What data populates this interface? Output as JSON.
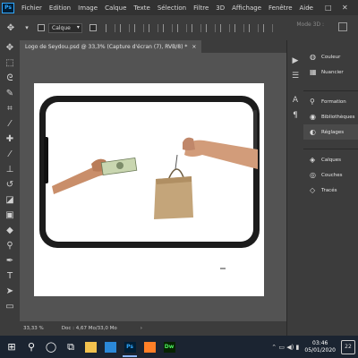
{
  "app": {
    "logo": "Ps"
  },
  "menu": [
    "Fichier",
    "Edition",
    "Image",
    "Calque",
    "Texte",
    "Sélection",
    "Filtre",
    "3D",
    "Affichage",
    "Fenêtre",
    "Aide"
  ],
  "window_controls": {
    "minimize": "–",
    "maximize": "□",
    "close": "✕"
  },
  "options": {
    "select_value": "Calque",
    "mode3d_label": "Mode 3D :"
  },
  "document": {
    "tab_title": "Logo de Seydou.psd @ 33,3% (Capture d'écran  (7), RVB/8) *",
    "close": "×"
  },
  "tools": [
    {
      "name": "move-tool",
      "icon": "✥"
    },
    {
      "name": "marquee-tool",
      "icon": "⬚"
    },
    {
      "name": "lasso-tool",
      "icon": "ᘓ"
    },
    {
      "name": "quick-select-tool",
      "icon": "✎"
    },
    {
      "name": "crop-tool",
      "icon": "⌗"
    },
    {
      "name": "eyedropper-tool",
      "icon": "⁄"
    },
    {
      "name": "healing-tool",
      "icon": "✚"
    },
    {
      "name": "brush-tool",
      "icon": "⁄"
    },
    {
      "name": "stamp-tool",
      "icon": "⊥"
    },
    {
      "name": "history-brush-tool",
      "icon": "↺"
    },
    {
      "name": "eraser-tool",
      "icon": "◪"
    },
    {
      "name": "gradient-tool",
      "icon": "▣"
    },
    {
      "name": "blur-tool",
      "icon": "◆"
    },
    {
      "name": "dodge-tool",
      "icon": "⚲"
    },
    {
      "name": "pen-tool",
      "icon": "✒"
    },
    {
      "name": "type-tool",
      "icon": "T"
    },
    {
      "name": "path-select-tool",
      "icon": "➤"
    },
    {
      "name": "shape-tool",
      "icon": "▭"
    }
  ],
  "panel_strip_icons": [
    "▶",
    "☰",
    "A",
    "¶"
  ],
  "panels": [
    {
      "name": "panel-couleur",
      "icon": "◍",
      "label": "Couleur"
    },
    {
      "name": "panel-nuancier",
      "icon": "▦",
      "label": "Nuancier"
    },
    {
      "name": "panel-formation",
      "icon": "⚲",
      "label": "Formation"
    },
    {
      "name": "panel-bibliotheques",
      "icon": "◉",
      "label": "Bibliothèques"
    },
    {
      "name": "panel-reglages",
      "icon": "◐",
      "label": "Réglages"
    },
    {
      "name": "panel-calques",
      "icon": "◈",
      "label": "Calques"
    },
    {
      "name": "panel-couches",
      "icon": "◎",
      "label": "Couches"
    },
    {
      "name": "panel-traces",
      "icon": "◇",
      "label": "Tracés"
    }
  ],
  "status": {
    "zoom": "33,33 %",
    "doc": "Doc : 4,67 Mo/33,0 Mo",
    "arrow": "›"
  },
  "taskbar": {
    "start": "⊞",
    "search": "⚲",
    "cortana": "◯",
    "taskview": "⧉",
    "apps": [
      {
        "name": "taskbar-file-explorer",
        "label": "",
        "bg": "#f2c14e",
        "fg": "#7a5a00",
        "running": false
      },
      {
        "name": "taskbar-store",
        "label": "",
        "bg": "#2b88d8",
        "fg": "#ffffff",
        "running": false
      },
      {
        "name": "taskbar-photoshop",
        "label": "Ps",
        "bg": "#001e36",
        "fg": "#31a8ff",
        "running": true
      },
      {
        "name": "taskbar-app-orange",
        "label": "",
        "bg": "#ff7f27",
        "fg": "#ffffff",
        "running": false
      },
      {
        "name": "taskbar-dreamweaver",
        "label": "Dw",
        "bg": "#072401",
        "fg": "#4cf160",
        "running": false
      }
    ],
    "tray_icons": "⌃  ▭  ◀)  ▮",
    "time": "03:46",
    "date": "05/01/2020",
    "notification": "22"
  }
}
